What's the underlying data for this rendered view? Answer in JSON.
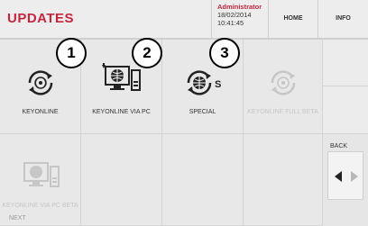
{
  "header": {
    "title": "UPDATES",
    "user": {
      "name": "Administrator",
      "date": "18/02/2014",
      "time": "10:41:45"
    },
    "home_label": "HOME",
    "info_label": "INFO"
  },
  "grid": {
    "items": [
      {
        "label": "KEYONLINE",
        "icon": "keyonline-sync-icon",
        "enabled": true,
        "badge": "1"
      },
      {
        "label": "KEYONLINE VIA PC",
        "icon": "computer-globe-icon",
        "enabled": true,
        "badge": "2"
      },
      {
        "label": "SPECIAL",
        "icon": "special-sync-icon",
        "enabled": true,
        "badge": "3"
      },
      {
        "label": "KEYONLINE FULL BETA",
        "icon": "keyonline-sync-icon",
        "enabled": false
      },
      {
        "label": "KEYONLINE VIA PC BETA",
        "icon": "computer-globe-icon",
        "enabled": false
      }
    ]
  },
  "side": {
    "back_label": "BACK",
    "next_label": "NEXT"
  },
  "colors": {
    "accent": "#c5263f",
    "background": "#e6e6e6",
    "disabled": "#c6c6c6"
  }
}
